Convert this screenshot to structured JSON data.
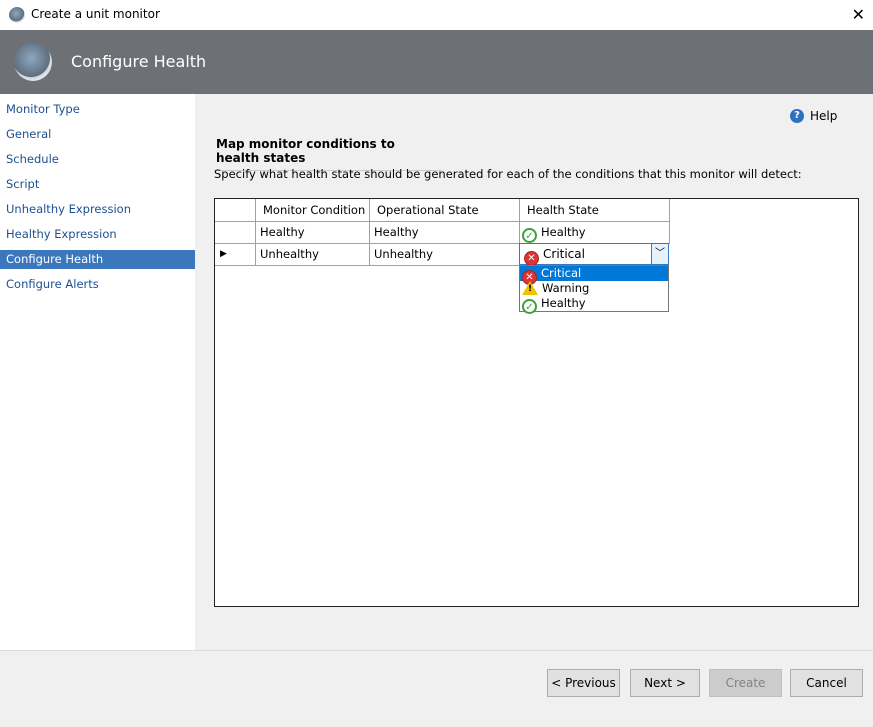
{
  "window": {
    "title": "Create a unit monitor",
    "close_icon": "close-icon"
  },
  "header": {
    "title": "Configure Health"
  },
  "nav": {
    "items": [
      {
        "label": "Monitor Type"
      },
      {
        "label": "General"
      },
      {
        "label": "Schedule"
      },
      {
        "label": "Script"
      },
      {
        "label": "Unhealthy Expression"
      },
      {
        "label": "Healthy Expression"
      },
      {
        "label": "Configure Health",
        "selected": true
      },
      {
        "label": "Configure Alerts"
      }
    ]
  },
  "help": {
    "label": "Help"
  },
  "section": {
    "title": "Map monitor conditions to health states",
    "description": "Specify what health state should be generated for each of the conditions that this monitor will detect:"
  },
  "grid": {
    "columns": [
      "Monitor Condition",
      "Operational State",
      "Health State"
    ],
    "rows": [
      {
        "condition": "Healthy",
        "operational": "Healthy",
        "health": "Healthy"
      },
      {
        "condition": "Unhealthy",
        "operational": "Unhealthy",
        "health": "Critical",
        "current": true
      }
    ]
  },
  "dropdown": {
    "selected": "Critical",
    "options": [
      "Critical",
      "Warning",
      "Healthy"
    ]
  },
  "buttons": {
    "previous": "< Previous",
    "next": "Next >",
    "create": "Create",
    "cancel": "Cancel"
  },
  "colors": {
    "header_bg": "#6d7175",
    "nav_selected": "#3b77bc",
    "option_selected": "#0078d7"
  }
}
